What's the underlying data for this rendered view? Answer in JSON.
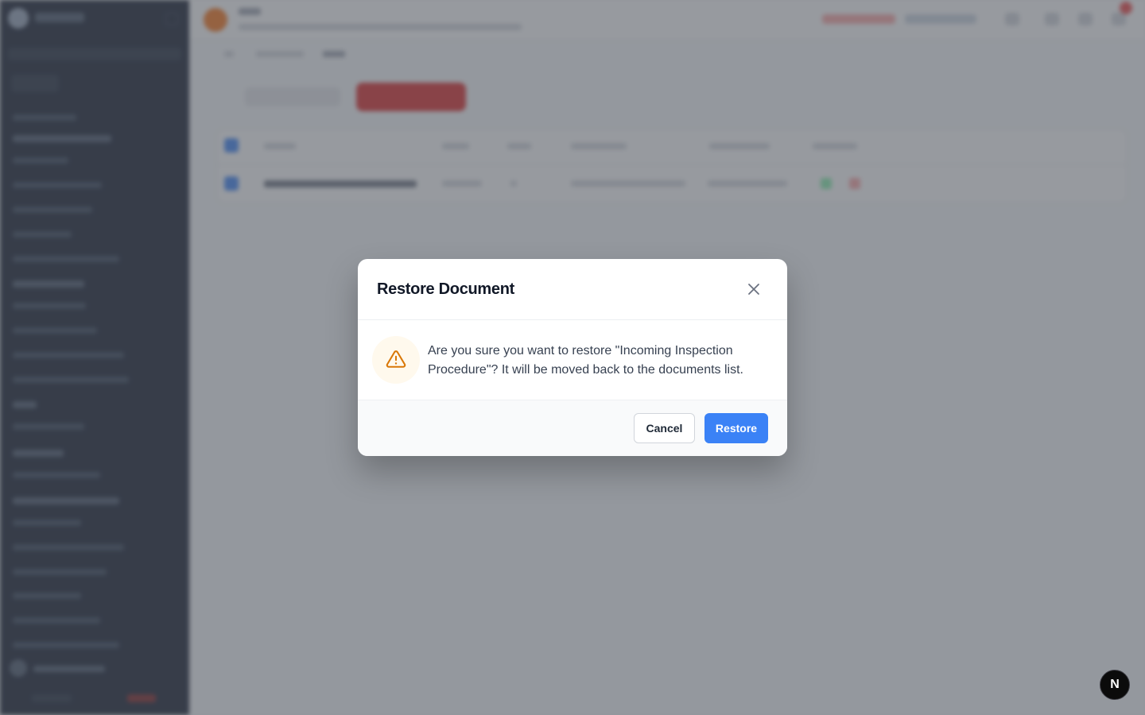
{
  "dialog": {
    "title": "Restore Document",
    "message": "Are you sure you want to restore \"Incoming Inspection Procedure\"? It will be moved back to the documents list.",
    "cancel_label": "Cancel",
    "confirm_label": "Restore",
    "icon": "warning-triangle-icon",
    "close_icon": "close-icon",
    "confirm_color": "#3b82f6",
    "warning_color": "#d97706"
  },
  "dev_badge": {
    "label": "N"
  }
}
